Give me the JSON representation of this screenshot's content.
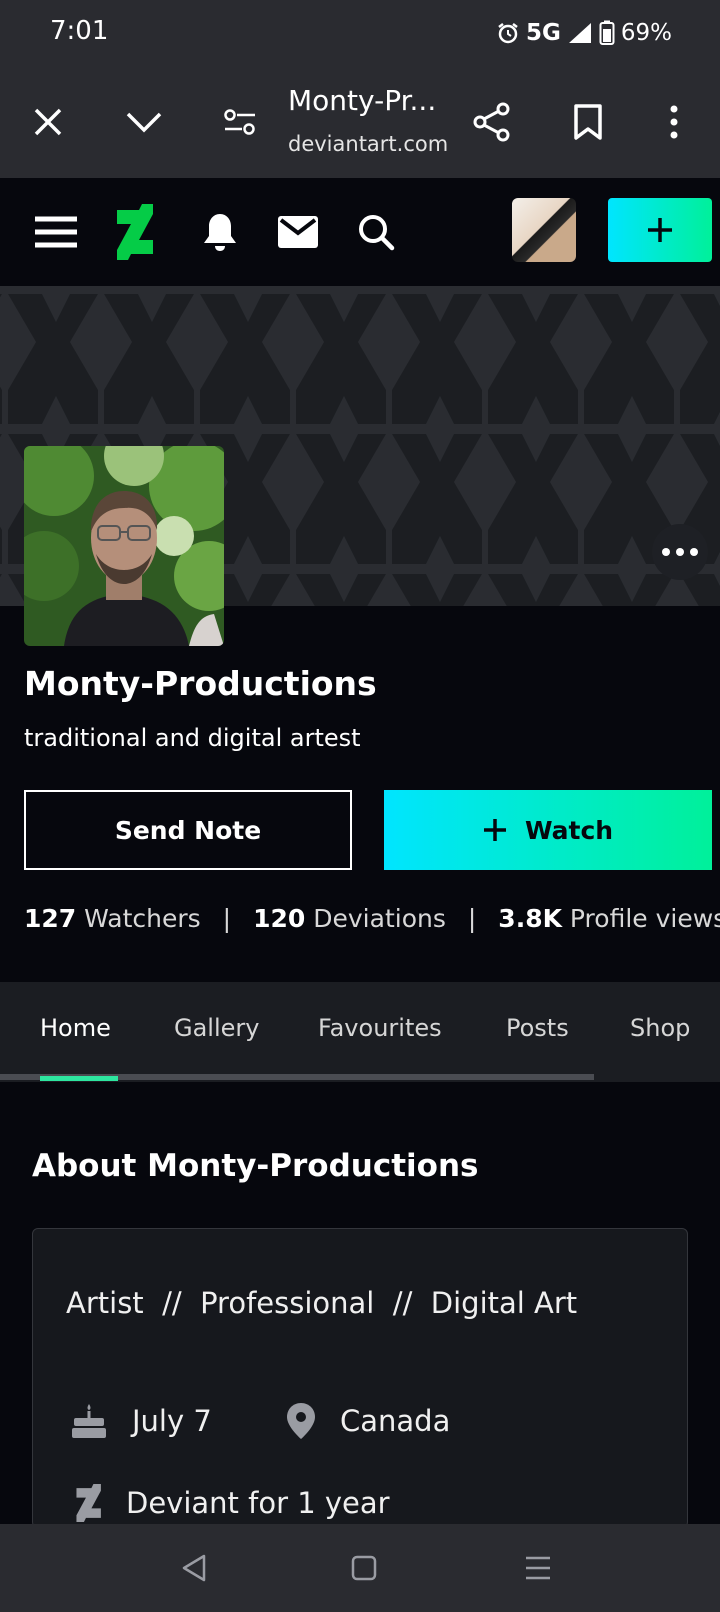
{
  "status_bar": {
    "time": "7:01",
    "network": "5G",
    "battery": "69%"
  },
  "browser": {
    "title": "Monty-Pr...",
    "url": "deviantart.com"
  },
  "profile": {
    "name": "Monty-Productions",
    "tagline": "traditional and digital artest",
    "send_note_label": "Send Note",
    "watch_label": "Watch",
    "stats": {
      "watchers_count": "127",
      "watchers_label": "Watchers",
      "deviations_count": "120",
      "deviations_label": "Deviations",
      "views_count": "3.8K",
      "views_label": "Profile views",
      "separator": "|"
    }
  },
  "tabs": [
    {
      "label": "Home",
      "active": true
    },
    {
      "label": "Gallery",
      "active": false
    },
    {
      "label": "Favourites",
      "active": false
    },
    {
      "label": "Posts",
      "active": false
    },
    {
      "label": "Shop",
      "active": false
    }
  ],
  "about": {
    "title": "About Monty-Productions",
    "roles": "Artist  //  Professional  //  Digital Art",
    "birthday": "July 7",
    "location": "Canada",
    "deviant_since": "Deviant for 1 year"
  },
  "colors": {
    "accent_start": "#00e5ff",
    "accent_end": "#00f09a",
    "brand_green": "#05cc47",
    "background": "#06070d"
  },
  "icons": {
    "close": "close-icon",
    "collapse": "chevron-down-icon",
    "site_settings": "tune-icon",
    "share": "share-icon",
    "bookmark": "bookmark-icon",
    "menu": "more-vertical-icon"
  }
}
